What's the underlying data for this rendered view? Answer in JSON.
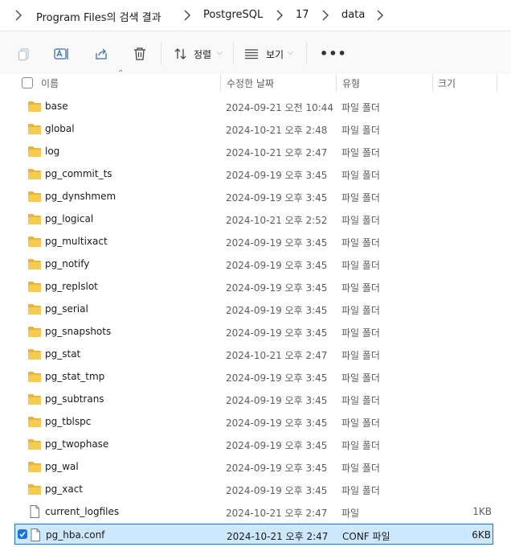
{
  "breadcrumb": {
    "items": [
      "Program Files의 검색 결과",
      "PostgreSQL",
      "17",
      "data"
    ]
  },
  "toolbar": {
    "sort_label": "정렬",
    "view_label": "보기",
    "more_label": "•••"
  },
  "columns": {
    "name": "이름",
    "modified": "수정한 날짜",
    "type": "유형",
    "size": "크기"
  },
  "files": [
    {
      "name": "base",
      "modified": "2024-09-21 오전 10:44",
      "type": "파일 폴더",
      "size": "",
      "kind": "folder"
    },
    {
      "name": "global",
      "modified": "2024-10-21 오후 2:48",
      "type": "파일 폴더",
      "size": "",
      "kind": "folder"
    },
    {
      "name": "log",
      "modified": "2024-10-21 오후 2:47",
      "type": "파일 폴더",
      "size": "",
      "kind": "folder"
    },
    {
      "name": "pg_commit_ts",
      "modified": "2024-09-19 오후 3:45",
      "type": "파일 폴더",
      "size": "",
      "kind": "folder"
    },
    {
      "name": "pg_dynshmem",
      "modified": "2024-09-19 오후 3:45",
      "type": "파일 폴더",
      "size": "",
      "kind": "folder"
    },
    {
      "name": "pg_logical",
      "modified": "2024-10-21 오후 2:52",
      "type": "파일 폴더",
      "size": "",
      "kind": "folder"
    },
    {
      "name": "pg_multixact",
      "modified": "2024-09-19 오후 3:45",
      "type": "파일 폴더",
      "size": "",
      "kind": "folder"
    },
    {
      "name": "pg_notify",
      "modified": "2024-09-19 오후 3:45",
      "type": "파일 폴더",
      "size": "",
      "kind": "folder"
    },
    {
      "name": "pg_replslot",
      "modified": "2024-09-19 오후 3:45",
      "type": "파일 폴더",
      "size": "",
      "kind": "folder"
    },
    {
      "name": "pg_serial",
      "modified": "2024-09-19 오후 3:45",
      "type": "파일 폴더",
      "size": "",
      "kind": "folder"
    },
    {
      "name": "pg_snapshots",
      "modified": "2024-09-19 오후 3:45",
      "type": "파일 폴더",
      "size": "",
      "kind": "folder"
    },
    {
      "name": "pg_stat",
      "modified": "2024-10-21 오후 2:47",
      "type": "파일 폴더",
      "size": "",
      "kind": "folder"
    },
    {
      "name": "pg_stat_tmp",
      "modified": "2024-09-19 오후 3:45",
      "type": "파일 폴더",
      "size": "",
      "kind": "folder"
    },
    {
      "name": "pg_subtrans",
      "modified": "2024-09-19 오후 3:45",
      "type": "파일 폴더",
      "size": "",
      "kind": "folder"
    },
    {
      "name": "pg_tblspc",
      "modified": "2024-09-19 오후 3:45",
      "type": "파일 폴더",
      "size": "",
      "kind": "folder"
    },
    {
      "name": "pg_twophase",
      "modified": "2024-09-19 오후 3:45",
      "type": "파일 폴더",
      "size": "",
      "kind": "folder"
    },
    {
      "name": "pg_wal",
      "modified": "2024-09-19 오후 3:45",
      "type": "파일 폴더",
      "size": "",
      "kind": "folder"
    },
    {
      "name": "pg_xact",
      "modified": "2024-09-19 오후 3:45",
      "type": "파일 폴더",
      "size": "",
      "kind": "folder"
    },
    {
      "name": "current_logfiles",
      "modified": "2024-10-21 오후 2:47",
      "type": "파일",
      "size": "1KB",
      "kind": "file"
    },
    {
      "name": "pg_hba.conf",
      "modified": "2024-10-21 오후 2:47",
      "type": "CONF 파일",
      "size": "6KB",
      "kind": "file",
      "selected": true
    }
  ],
  "colors": {
    "folder": "#f0c040",
    "selection_bg": "#cce8ff",
    "selection_border": "#1a73d9"
  },
  "icons": {
    "copy": "copy-icon",
    "rename": "rename-icon",
    "share": "share-icon",
    "delete": "trash-icon",
    "sort": "sort-icon",
    "view": "view-list-icon",
    "more": "more-icon"
  }
}
